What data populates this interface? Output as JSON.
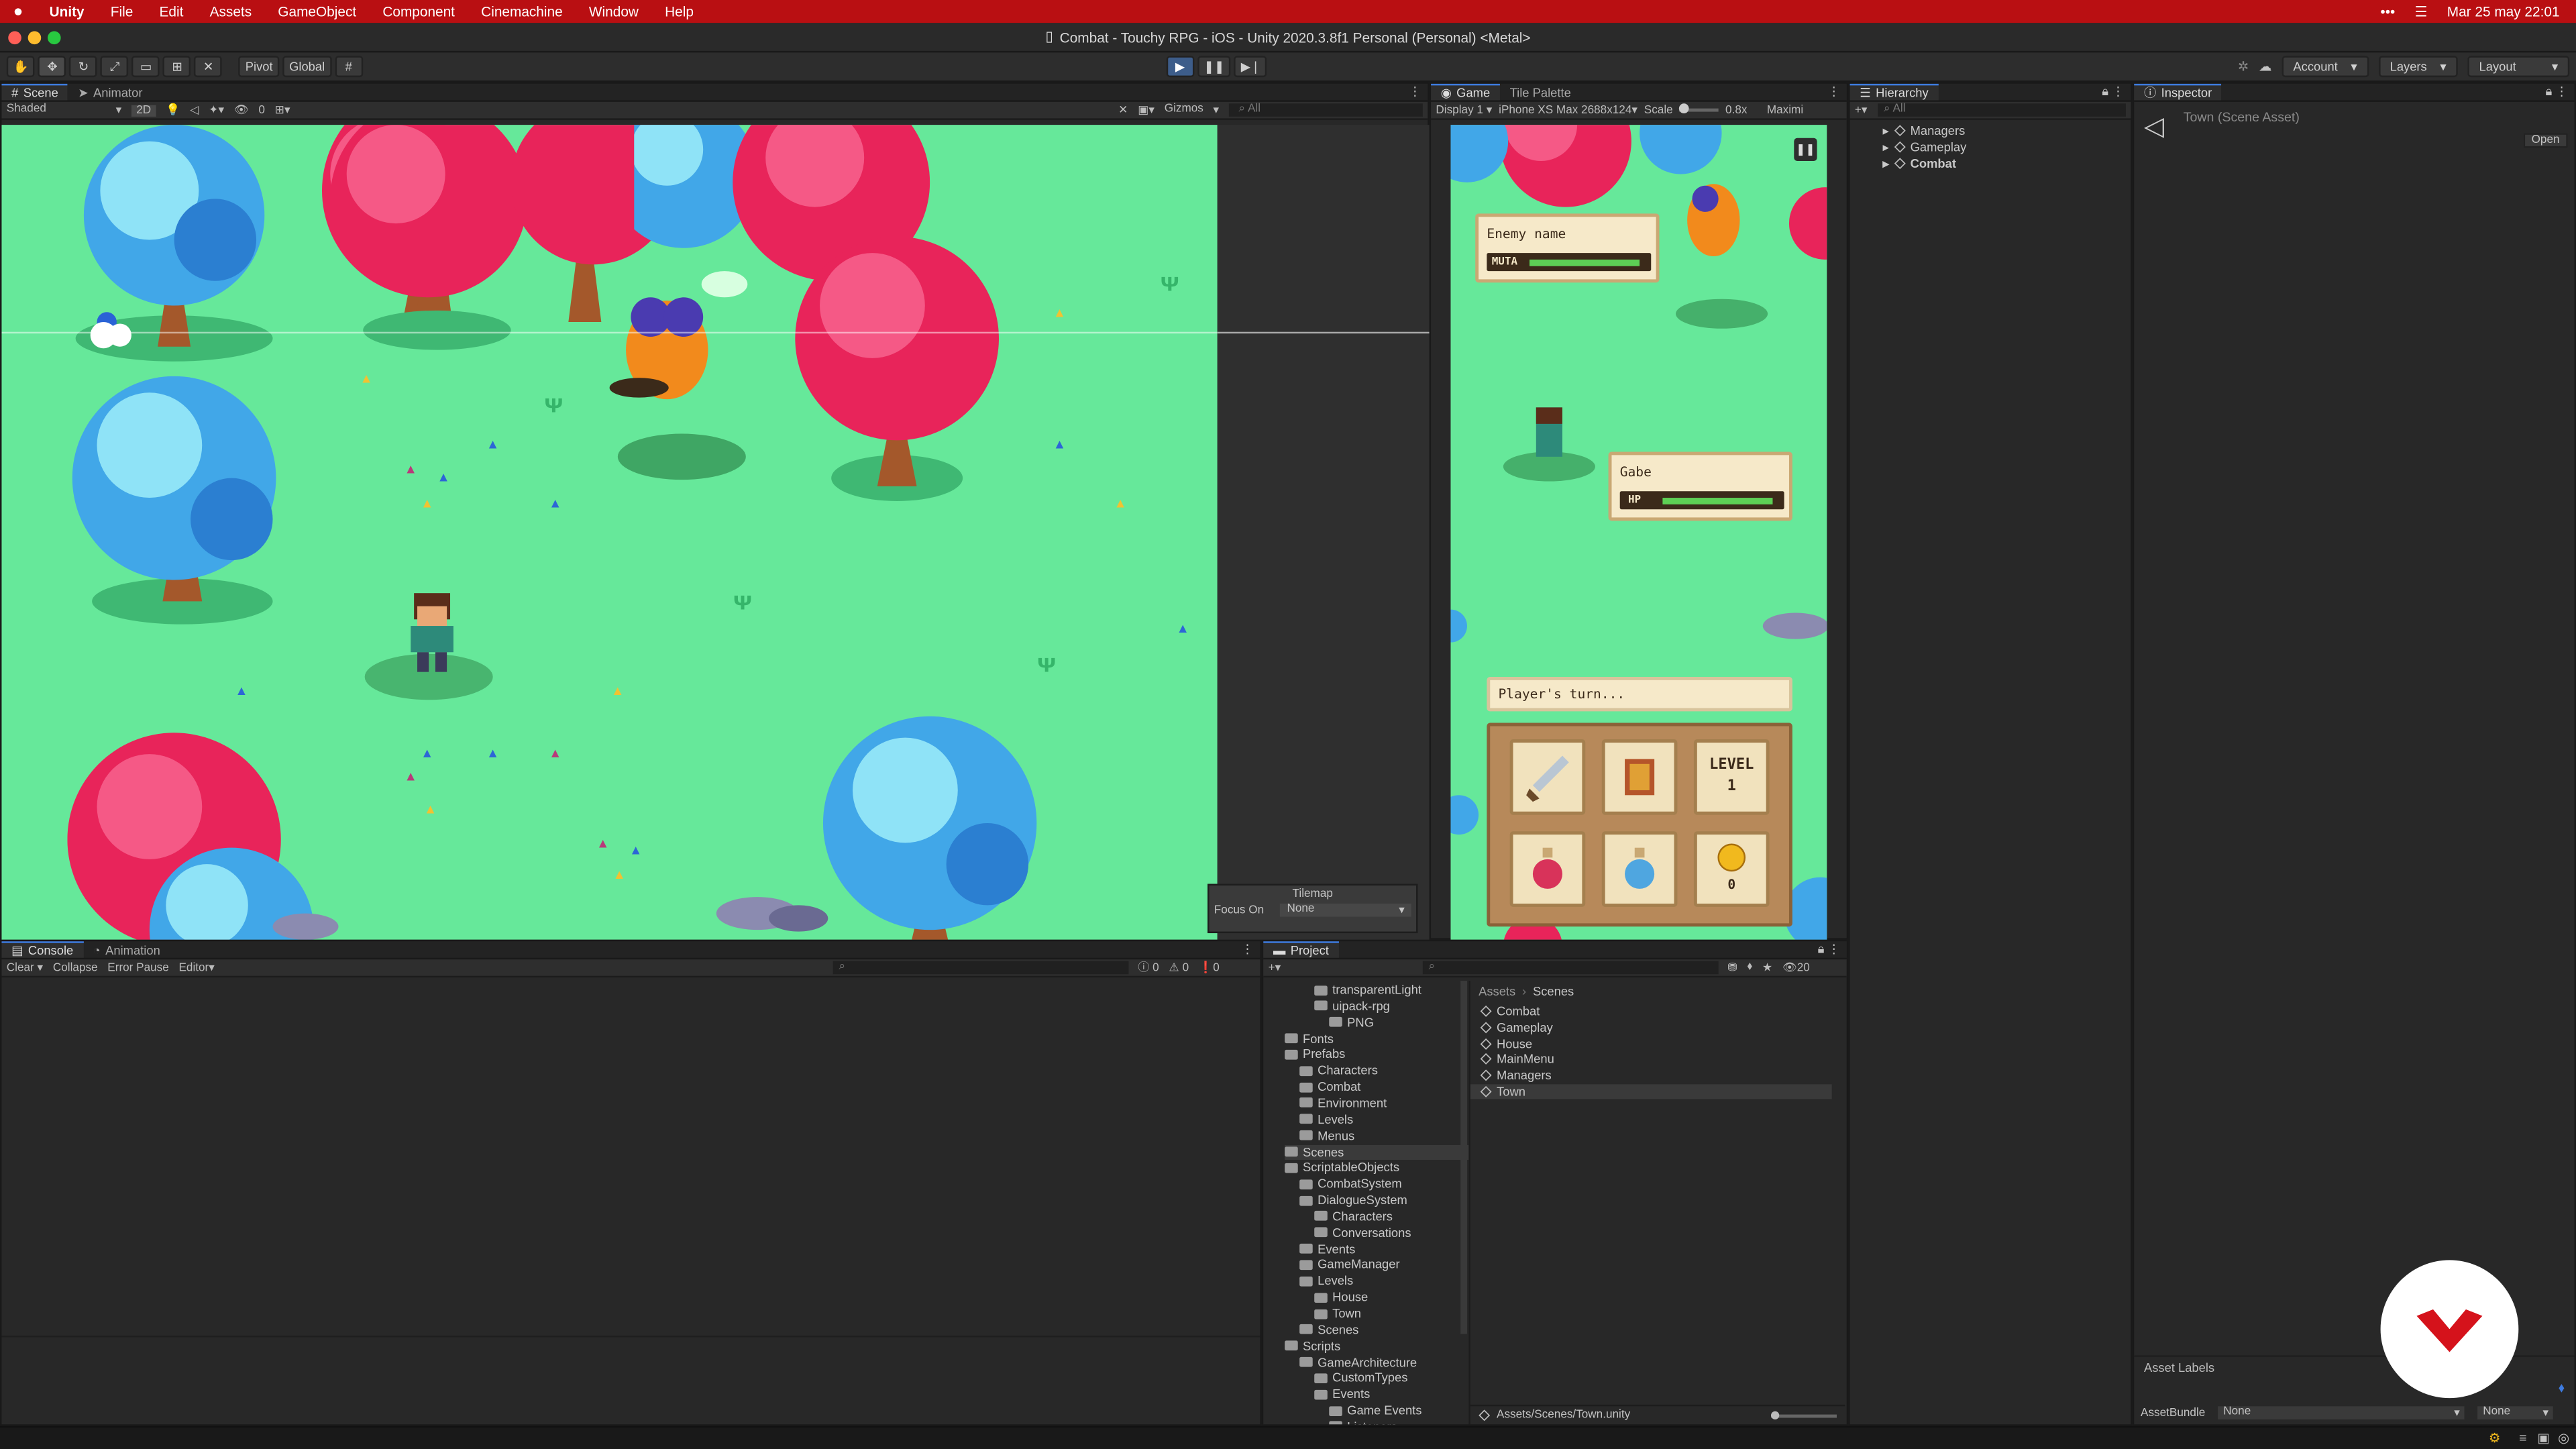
{
  "menubar": {
    "app": "Unity",
    "items": [
      "File",
      "Edit",
      "Assets",
      "GameObject",
      "Component",
      "Cinemachine",
      "Window",
      "Help"
    ],
    "datetime": "Mar 25 may  22:01"
  },
  "window": {
    "title": "Combat - Touchy RPG - iOS - Unity 2020.3.8f1 Personal (Personal) <Metal>"
  },
  "toolbar": {
    "pivot": "Pivot",
    "global": "Global",
    "account": "Account",
    "layers": "Layers",
    "layout": "Layout"
  },
  "scene_panel": {
    "tabs": [
      "Scene",
      "Animator"
    ],
    "shading": "Shaded",
    "mode2d": "2D",
    "gizmos": "Gizmos",
    "search": "All",
    "hidden_count": "0",
    "tilemap": {
      "title": "Tilemap",
      "focus_label": "Focus On",
      "focus_value": "None"
    }
  },
  "game_panel": {
    "tabs": [
      "Game",
      "Tile Palette"
    ],
    "display": "Display 1",
    "device": "iPhone XS Max 2688x124",
    "scale_label": "Scale",
    "scale_value": "0.8x",
    "maximize": "Maximi",
    "enemy": {
      "name": "Enemy name",
      "bar_label": "MUTA",
      "hp_fraction": 0.95
    },
    "player": {
      "name": "Gabe",
      "bar_label": "HP",
      "hp_fraction": 0.95
    },
    "turn_text": "Player's turn...",
    "level_label": "LEVEL",
    "level_value": "1",
    "coins": "0"
  },
  "hierarchy": {
    "tab": "Hierarchy",
    "search": "All",
    "items": [
      "Managers",
      "Gameplay",
      "Combat"
    ]
  },
  "inspector": {
    "tab": "Inspector",
    "asset": "Town (Scene Asset)",
    "open": "Open",
    "asset_labels": "Asset Labels",
    "assetbundle_label": "AssetBundle",
    "assetbundle_value": "None",
    "variant_value": "None"
  },
  "console": {
    "tabs": [
      "Console",
      "Animation"
    ],
    "buttons": [
      "Clear",
      "Collapse",
      "Error Pause",
      "Editor"
    ],
    "counts": {
      "logs": "0",
      "warnings": "0",
      "errors": "0"
    }
  },
  "project": {
    "tab": "Project",
    "count": "20",
    "tree": [
      {
        "label": "transparentLight",
        "depth": 3
      },
      {
        "label": "uipack-rpg",
        "depth": 3
      },
      {
        "label": "PNG",
        "depth": 4
      },
      {
        "label": "Fonts",
        "depth": 1
      },
      {
        "label": "Prefabs",
        "depth": 1
      },
      {
        "label": "Characters",
        "depth": 2
      },
      {
        "label": "Combat",
        "depth": 2
      },
      {
        "label": "Environment",
        "depth": 2
      },
      {
        "label": "Levels",
        "depth": 2
      },
      {
        "label": "Menus",
        "depth": 2
      },
      {
        "label": "Scenes",
        "depth": 1
      },
      {
        "label": "ScriptableObjects",
        "depth": 1
      },
      {
        "label": "CombatSystem",
        "depth": 2
      },
      {
        "label": "DialogueSystem",
        "depth": 2
      },
      {
        "label": "Characters",
        "depth": 3
      },
      {
        "label": "Conversations",
        "depth": 3
      },
      {
        "label": "Events",
        "depth": 2
      },
      {
        "label": "GameManager",
        "depth": 2
      },
      {
        "label": "Levels",
        "depth": 2
      },
      {
        "label": "House",
        "depth": 3
      },
      {
        "label": "Town",
        "depth": 3
      },
      {
        "label": "Scenes",
        "depth": 2
      },
      {
        "label": "Scripts",
        "depth": 1
      },
      {
        "label": "GameArchitecture",
        "depth": 2
      },
      {
        "label": "CustomTypes",
        "depth": 3
      },
      {
        "label": "Events",
        "depth": 3
      },
      {
        "label": "Game Events",
        "depth": 4
      },
      {
        "label": "Listeners",
        "depth": 4
      }
    ],
    "breadcrumb": [
      "Assets",
      "Scenes"
    ],
    "files": [
      "Combat",
      "Gameplay",
      "House",
      "MainMenu",
      "Managers",
      "Town"
    ],
    "path": "Assets/Scenes/Town.unity"
  },
  "colors": {
    "accent": "#3d7be0",
    "brand_red": "#b90f12",
    "grass": "#66e89a"
  }
}
